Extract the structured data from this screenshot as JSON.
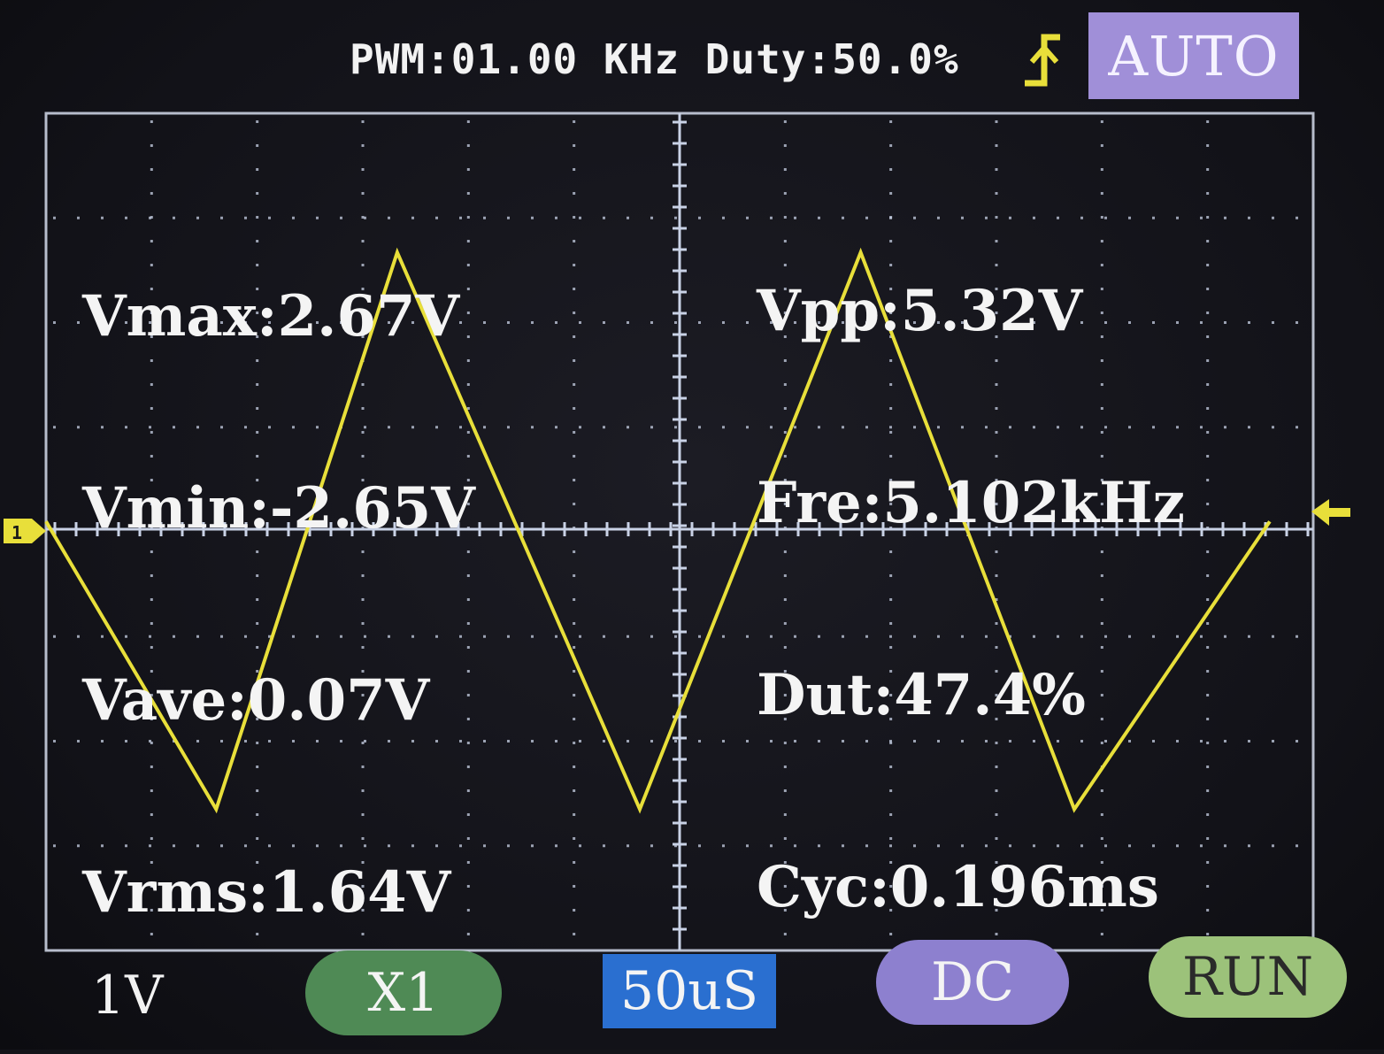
{
  "header": {
    "pwm_text": "PWM:01.00 KHz Duty:50.0%",
    "trigger_mode": "AUTO"
  },
  "measurements": {
    "left": [
      "Vmax:2.67V",
      "Vmin:-2.65V",
      "Vave:0.07V",
      "Vrms:1.64V"
    ],
    "right": [
      "Vpp:5.32V",
      "Fre:5.102kHz",
      "Dut:47.4%",
      "Cyc:0.196ms"
    ]
  },
  "channel_marker": "1",
  "footer": {
    "volt_div": "1V",
    "probe": "X1",
    "timebase": "50uS",
    "coupling": "DC",
    "run_state": "RUN"
  },
  "colors": {
    "trace": "#e8df3a",
    "grid": "#c9d2e6",
    "auto_badge": "#a08fd8",
    "probe_btn": "#4f8a55",
    "timebase_btn": "#2a6fd0",
    "coupling_btn": "#8d80cf",
    "run_btn": "#9cc27a"
  },
  "icons": {
    "trigger": "rising-edge-trigger-icon",
    "channel": "channel-1-marker-icon",
    "trigger_level": "trigger-level-arrow-icon"
  },
  "chart_data": {
    "type": "line",
    "waveform": "triangle",
    "x_unit": "us",
    "y_unit": "V",
    "x": [
      -175,
      -128,
      -78,
      -11,
      50,
      109,
      163
    ],
    "values": [
      0.1,
      -2.65,
      2.67,
      -2.65,
      2.67,
      -2.65,
      0.1
    ],
    "xlim": [
      -175,
      175
    ],
    "ylim": [
      -4,
      4
    ]
  }
}
